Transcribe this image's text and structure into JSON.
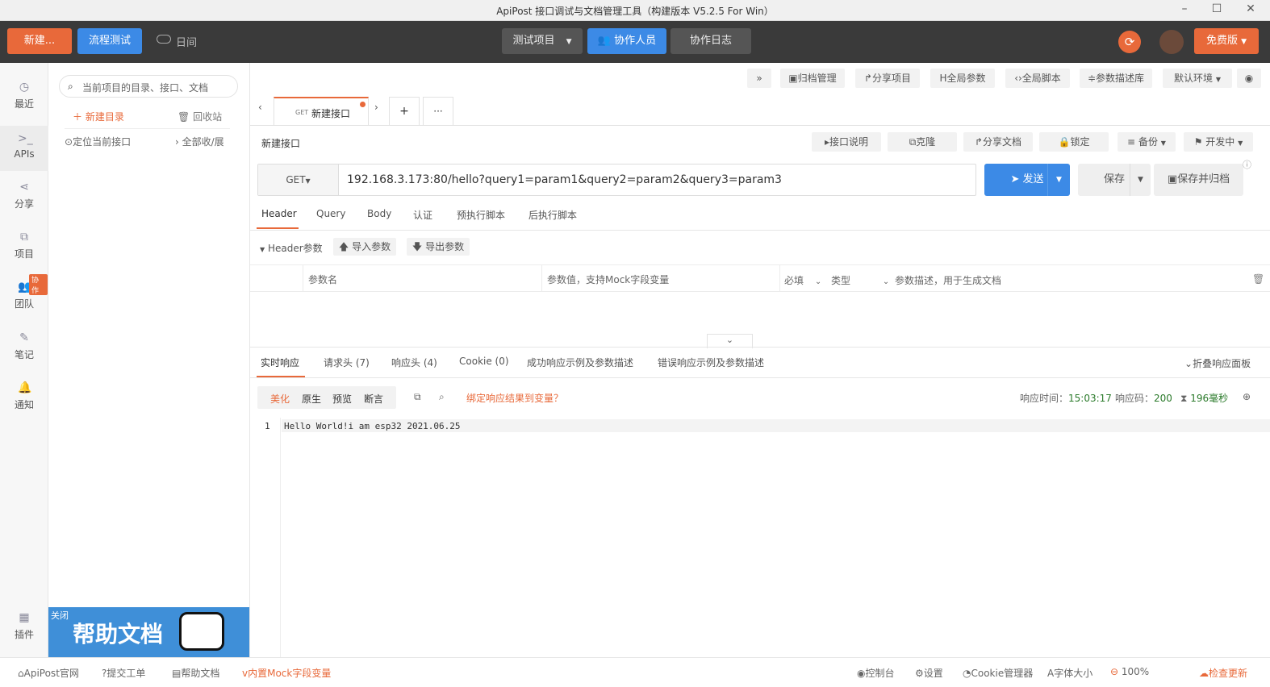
{
  "window": {
    "title": "ApiPost 接口调试与文档管理工具（构建版本 V5.2.5 For Win）",
    "minimize": "–",
    "maximize": "☐",
    "close": "✕"
  },
  "topbar": {
    "new_label": "新建...",
    "flow_test_label": "流程测试",
    "log_label": "日间",
    "project_label": "测试项目",
    "collaborators_label": "协作人员",
    "collab_log_label": "协作日志",
    "free_label": "免费版"
  },
  "sidebar": {
    "items": [
      {
        "label": "最近",
        "icon": "clock-icon"
      },
      {
        "label": "APIs",
        "icon": "terminal-icon"
      },
      {
        "label": "分享",
        "icon": "share-icon"
      },
      {
        "label": "项目",
        "icon": "project-icon"
      },
      {
        "label": "团队",
        "icon": "team-icon"
      },
      {
        "label": "笔记",
        "icon": "note-icon"
      },
      {
        "label": "通知",
        "icon": "bell-icon"
      }
    ],
    "team_badge": "协作",
    "plugins_label": "插件"
  },
  "tree": {
    "search_placeholder": "当前项目的目录、接口、文档",
    "new_dir": "新建目录",
    "recycle": "回收站",
    "locate": "定位当前接口",
    "expand_all": "全部收/展",
    "banner_close": "关闭",
    "banner_title": "帮助文档"
  },
  "toolbar": {
    "expand": "»",
    "archive": "归档管理",
    "share_project": "分享项目",
    "global_params": "全局参数",
    "global_script": "全局脚本",
    "param_lib": "参数描述库",
    "env": "默认环境"
  },
  "tabs": {
    "active_method": "GET",
    "active_name": "新建接口",
    "add": "+",
    "more": "···"
  },
  "api": {
    "name": "新建接口",
    "doc": "接口说明",
    "clone": "克隆",
    "share_doc": "分享文档",
    "lock": "锁定",
    "backup": "备份",
    "status": "开发中",
    "method": "GET",
    "url": "192.168.3.173:80/hello?query1=param1&query2=param2&query3=param3",
    "send": "发送",
    "save": "保存",
    "save_archive": "保存并归档"
  },
  "req_tabs": [
    "Header",
    "Query",
    "Body",
    "认证",
    "预执行脚本",
    "后执行脚本"
  ],
  "header_section": {
    "title": "Header参数",
    "import": "导入参数",
    "export": "导出参数",
    "col_name": "参数名",
    "col_value": "参数值，支持Mock字段变量",
    "col_required": "必填",
    "col_type": "类型",
    "col_desc": "参数描述，用于生成文档"
  },
  "resp_tabs": [
    "实时响应",
    "请求头 (7)",
    "响应头 (4)",
    "Cookie (0)",
    "成功响应示例及参数描述",
    "错误响应示例及参数描述"
  ],
  "resp_collapse": "折叠响应面板",
  "resp_view": [
    "美化",
    "原生",
    "预览",
    "断言"
  ],
  "resp_bind": "绑定响应结果到变量？",
  "resp_time_label": "响应时间：",
  "resp_time": "15:03:17",
  "resp_code_label": "响应码：",
  "resp_code": "200",
  "resp_duration": "196毫秒",
  "response_body": {
    "line": "1",
    "text": "Hello World!i am esp32 2021.06.25"
  },
  "statusbar": {
    "official": "ApiPost官网",
    "ticket": "提交工单",
    "help": "帮助文档",
    "mock": "内置Mock字段变量",
    "console": "控制台",
    "settings": "设置",
    "cookie": "Cookie管理器",
    "font": "字体大小",
    "zoom": "100%",
    "update": "检查更新"
  },
  "colors": {
    "orange": "#e8693a",
    "blue": "#3c8ae6",
    "dark": "#3a3a3a"
  }
}
